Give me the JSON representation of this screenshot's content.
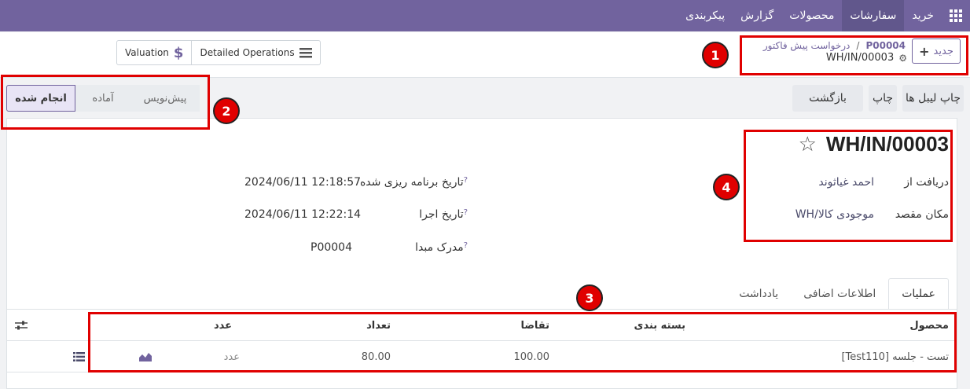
{
  "topbar": {
    "menu": [
      {
        "label": "خرید"
      },
      {
        "label": "سفارشات",
        "active": true
      },
      {
        "label": "محصولات"
      },
      {
        "label": "گزارش"
      },
      {
        "label": "پیکربندی"
      }
    ]
  },
  "control_panel": {
    "new_button": "جدید",
    "breadcrumb": {
      "parent": "درخواست پیش فاکتور",
      "reference": "P00004"
    },
    "record_name": "WH/IN/00003",
    "actions": {
      "detailed_operations": "Detailed Operations",
      "valuation": "Valuation"
    }
  },
  "statusbar": {
    "buttons": {
      "print_labels": "چاپ لیبل ها",
      "print": "چاپ",
      "return": "بازگشت"
    },
    "stages": [
      {
        "label": "پیش‌نویس"
      },
      {
        "label": "آماده"
      },
      {
        "label": "انجام شده",
        "current": true
      }
    ]
  },
  "form": {
    "title": "WH/IN/00003",
    "fields": {
      "receive_from": {
        "label": "دریافت از",
        "value": "احمد غیاثوند"
      },
      "destination": {
        "label": "مکان مقصد",
        "value": "WH/موجودی کالا"
      },
      "scheduled_date": {
        "label": "تاریخ برنامه ریزی شده",
        "help": "?",
        "value": "2024/06/11 12:18:57"
      },
      "effective_date": {
        "label": "تاریخ اجرا",
        "help": "?",
        "value": "2024/06/11 12:22:14"
      },
      "source_document": {
        "label": "مدرک مبدا",
        "help": "?",
        "value": "P00004"
      }
    }
  },
  "tabs": [
    {
      "label": "عملیات",
      "active": true
    },
    {
      "label": "اطلاعات اضافی"
    },
    {
      "label": "یادداشت"
    }
  ],
  "operations_table": {
    "headers": {
      "product": "محصول",
      "packaging": "بسته بندی",
      "demand": "تقاضا",
      "quantity": "تعداد",
      "unit": "عدد"
    },
    "rows": [
      {
        "product": "[Test110] تست - جلسه",
        "packaging": "",
        "demand": "100.00",
        "quantity": "80.00",
        "unit": "عدد"
      }
    ]
  },
  "annotations": [
    {
      "label": "1"
    },
    {
      "label": "2"
    },
    {
      "label": "3"
    },
    {
      "label": "4"
    }
  ],
  "colors": {
    "brand": "#71639e",
    "annotation": "#e00000"
  }
}
